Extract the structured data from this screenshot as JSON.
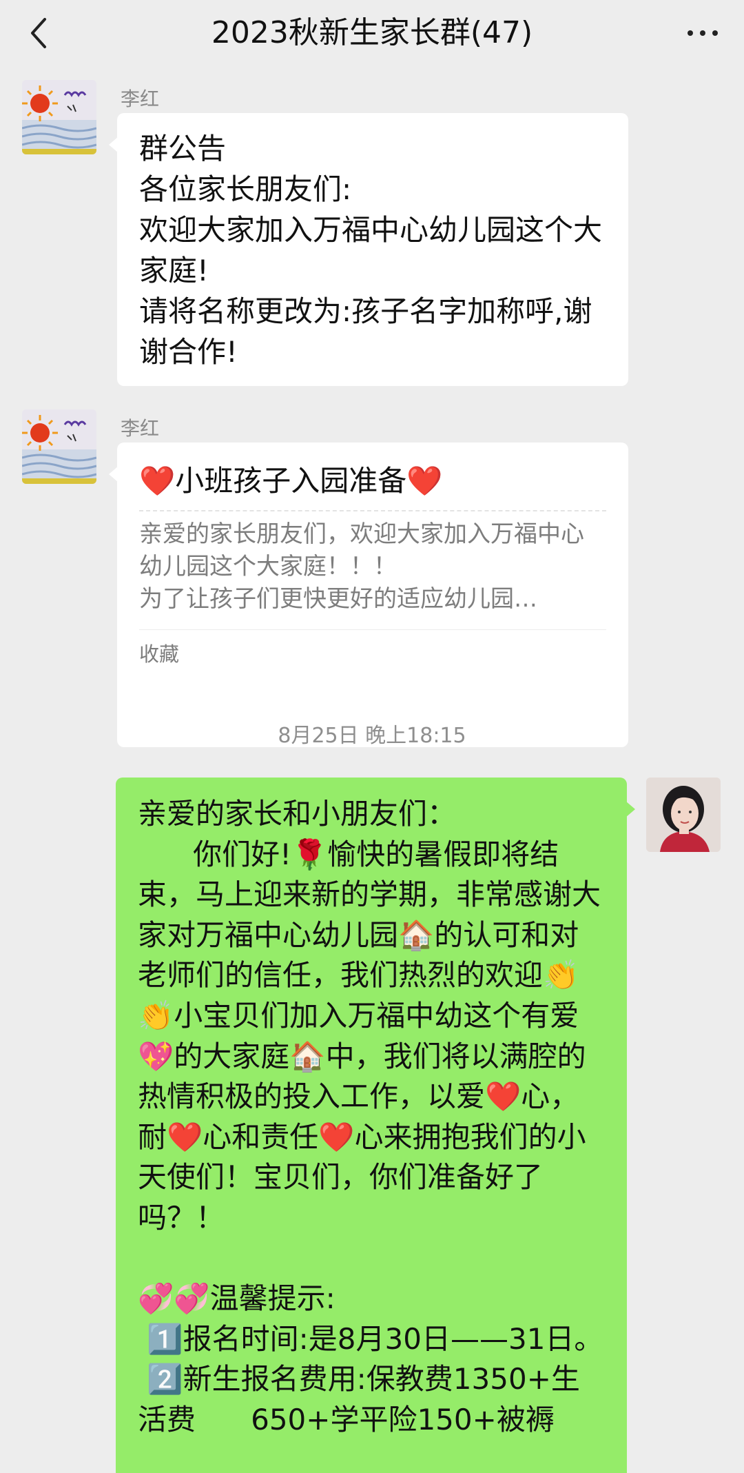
{
  "header": {
    "title": "2023秋新生家长群(47)",
    "back_icon": "chevron-left-icon",
    "more_icon": "more-dots-icon"
  },
  "messages": [
    {
      "sender": "李红",
      "type": "text",
      "text": "群公告\n各位家长朋友们:\n欢迎大家加入万福中心幼儿园这个大家庭!\n请将名称更改为:孩子名字加称呼,谢谢合作!"
    },
    {
      "sender": "李红",
      "type": "card",
      "title": "❤️小班孩子入园准备❤️",
      "preview": "亲爱的家长朋友们，欢迎大家加入万福中心幼儿园这个大家庭！！！\n为了让孩子们更快更好的适应幼儿园…",
      "footer": "收藏"
    }
  ],
  "timestamp": "8月25日 晚上18:15",
  "my_message": {
    "text": "亲爱的家长和小朋友们：\n      你们好!🌹愉快的暑假即将结束，马上迎来新的学期，非常感谢大家对万福中心幼儿园🏠的认可和对老师们的信任，我们热烈的欢迎👏👏小宝贝们加入万福中幼这个有爱💖的大家庭🏠中，我们将以满腔的热情积极的投入工作，以爱❤️心，耐❤️心和责任❤️心来拥抱我们的小天使们！宝贝们，你们准备好了吗？！\n\n💞💞温馨提示:\n 1️⃣报名时间:是8月30日——31日。\n 2️⃣新生报名费用:保教费1350+生活费      650+学平险150+被褥"
  },
  "colors": {
    "background": "#ededed",
    "incoming_bubble": "#ffffff",
    "outgoing_bubble": "#95ec69",
    "meta_text": "#8a8a8a"
  }
}
